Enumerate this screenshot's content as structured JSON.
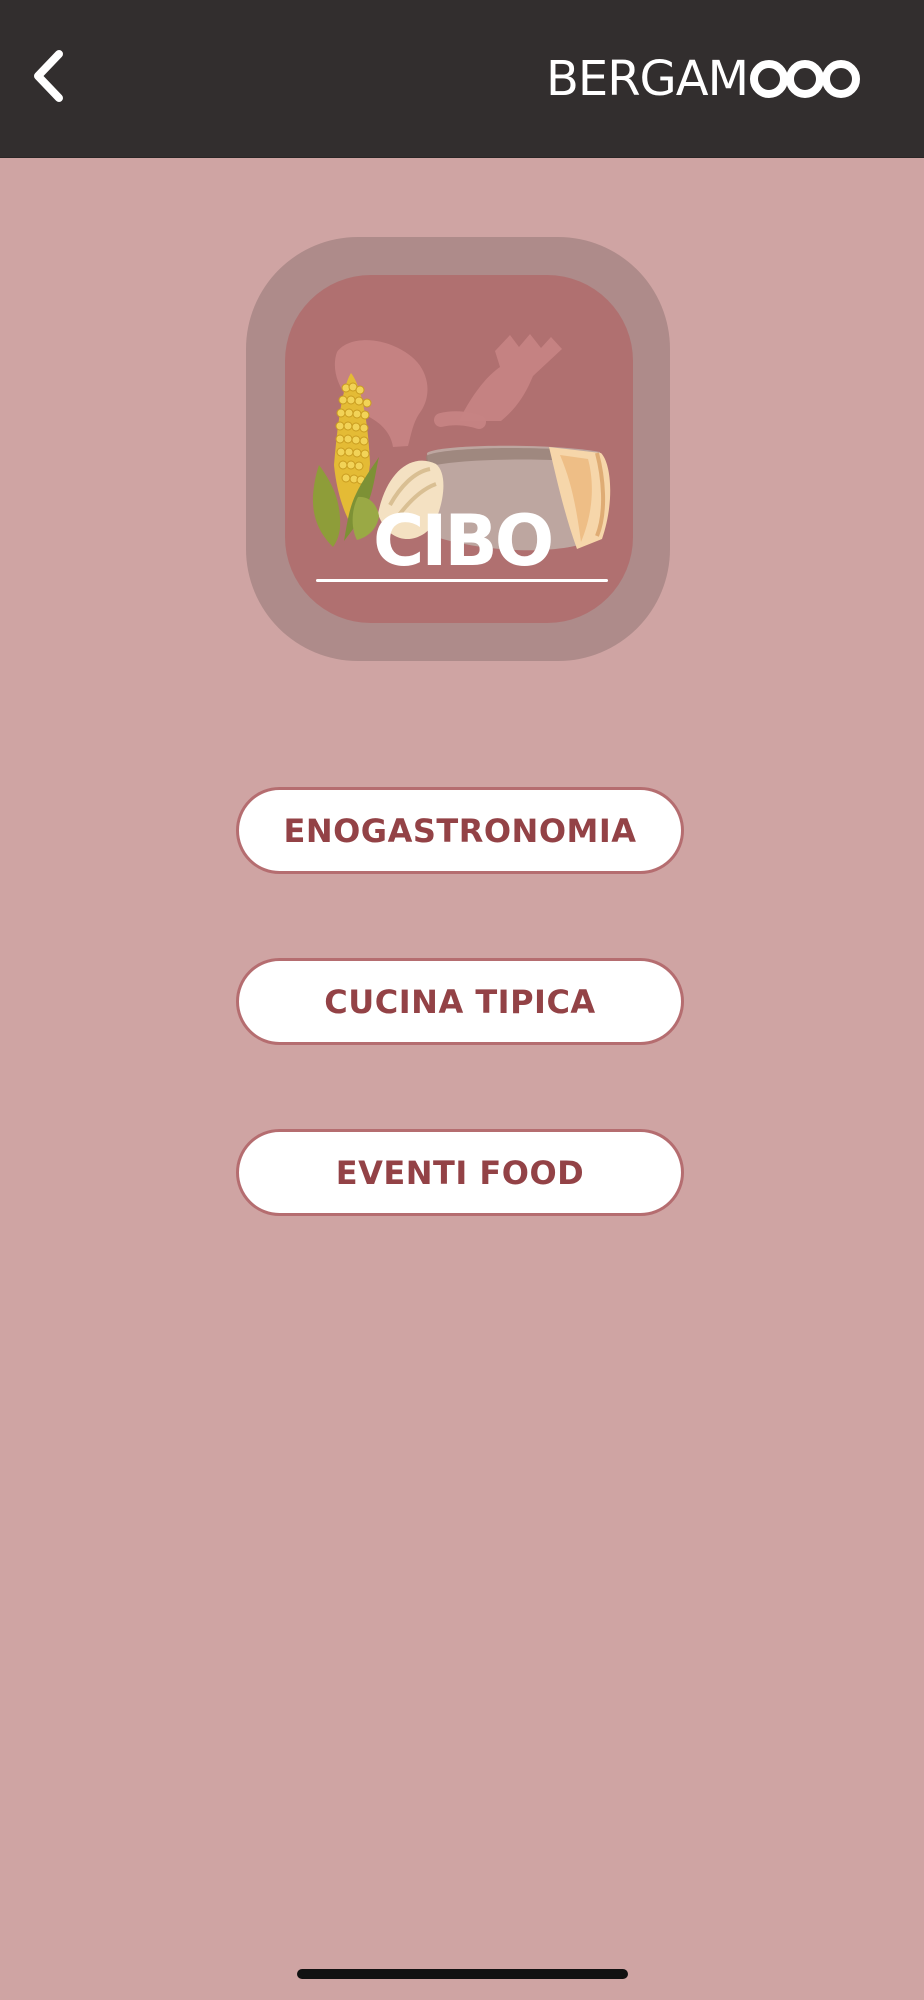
{
  "header": {
    "back_label": "",
    "logo_text": "BERGAM",
    "logo_suffix_icon": "three-rings-icon",
    "background": "#322e2e"
  },
  "hero": {
    "title": "CIBO",
    "icon": "food-category-icon",
    "outer_color": "#ae8b8a",
    "inner_color": "#b07070"
  },
  "menu": {
    "items": [
      {
        "label": "ENOGASTRONOMIA"
      },
      {
        "label": "CUCINA TIPICA"
      },
      {
        "label": "EVENTI FOOD"
      }
    ],
    "button_text_color": "#934246",
    "button_border_color": "#b56d70"
  },
  "page": {
    "background": "#cfa4a3"
  },
  "system": {
    "home_indicator": "home-indicator"
  }
}
